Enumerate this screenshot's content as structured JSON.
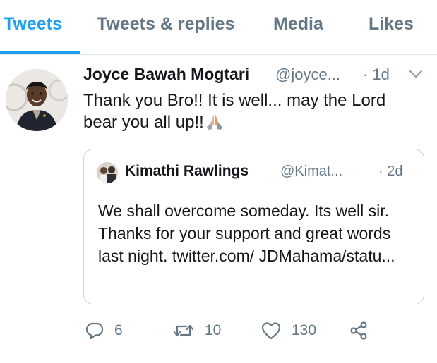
{
  "tabs": [
    {
      "label": "Tweets",
      "active": true
    },
    {
      "label": "Tweets & replies",
      "active": false
    },
    {
      "label": "Media",
      "active": false
    },
    {
      "label": "Likes",
      "active": false
    }
  ],
  "tweet": {
    "author_name": "Joyce Bawah Mogtari",
    "author_handle": "@joyce...",
    "time": "· 1d",
    "text": "Thank you Bro!! It is well... may the Lord bear you all up!!",
    "emoji": "folded-hands",
    "quoted": {
      "author_name": "Kimathi Rawlings",
      "author_handle": "@Kimat...",
      "time": "· 2d",
      "text": "We shall overcome someday. Its well sir. Thanks for your support and great words last night. twitter.com/ JDMahama/statu..."
    },
    "actions": {
      "replies": "6",
      "retweets": "10",
      "likes": "130"
    }
  },
  "colors": {
    "accent": "#1da1f2",
    "muted": "#657786",
    "text": "#14171a",
    "border": "#ccd6dd"
  }
}
